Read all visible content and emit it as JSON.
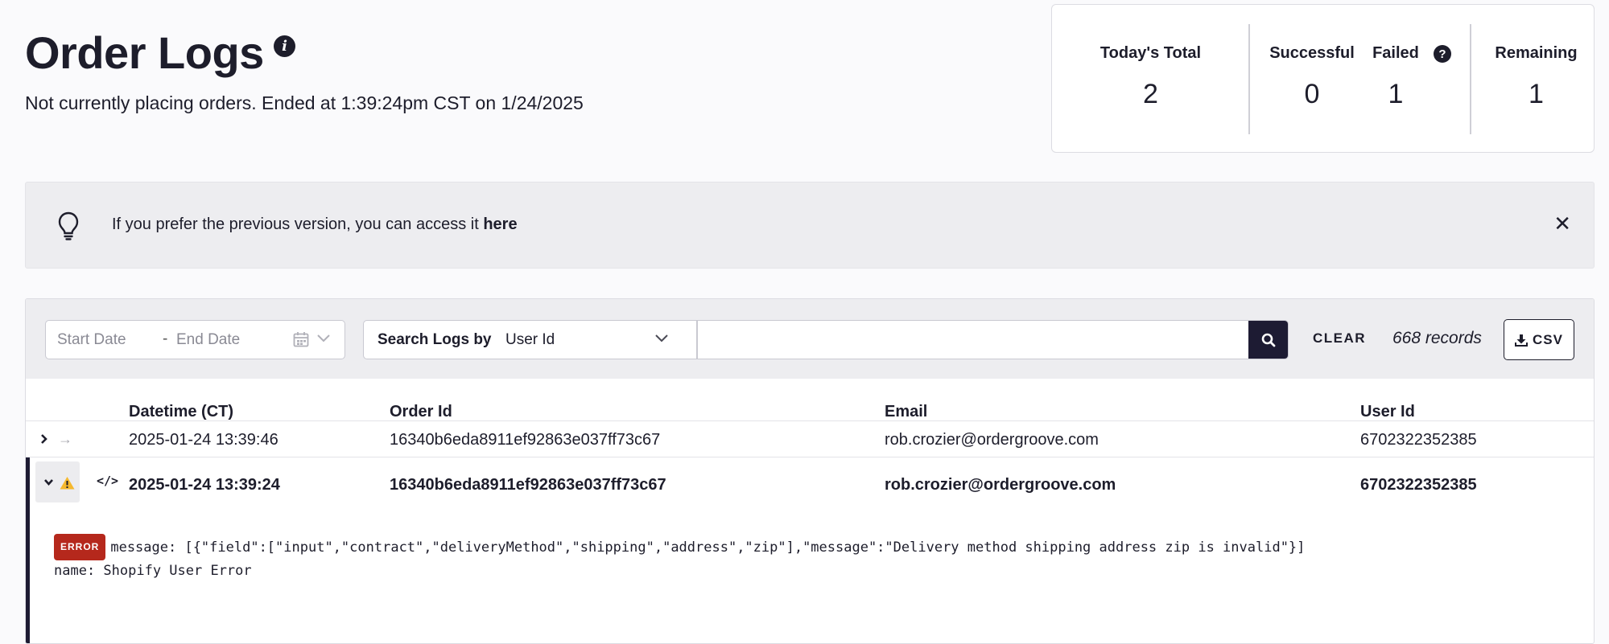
{
  "header": {
    "title": "Order Logs",
    "status": "Not currently placing orders. Ended at 1:39:24pm CST on 1/24/2025"
  },
  "stats": {
    "todays_total": {
      "label": "Today's Total",
      "value": "2"
    },
    "successful": {
      "label": "Successful",
      "value": "0"
    },
    "failed": {
      "label": "Failed",
      "value": "1"
    },
    "remaining": {
      "label": "Remaining",
      "value": "1"
    }
  },
  "banner": {
    "text": "If you prefer the previous version, you can access it ",
    "link_label": "here"
  },
  "toolbar": {
    "start_date_placeholder": "Start Date",
    "date_separator": "-",
    "end_date_placeholder": "End Date",
    "search_by_label": "Search Logs by",
    "search_by_value": "User Id",
    "search_value": "",
    "clear_label": "CLEAR",
    "record_count": "668 records",
    "csv_label": "CSV"
  },
  "table": {
    "columns": [
      "Datetime (CT)",
      "Order Id",
      "Email",
      "User Id"
    ],
    "rows": [
      {
        "datetime": "2025-01-24 13:39:46",
        "order_id": "16340b6eda8911ef92863e037ff73c67",
        "email": "rob.crozier@ordergroove.com",
        "user_id": "6702322352385",
        "status": "success",
        "expanded": false
      },
      {
        "datetime": "2025-01-24 13:39:24",
        "order_id": "16340b6eda8911ef92863e037ff73c67",
        "email": "rob.crozier@ordergroove.com",
        "user_id": "6702322352385",
        "status": "warning",
        "expanded": true,
        "error": {
          "badge": "ERROR",
          "message": "message: [{\"field\":[\"input\",\"contract\",\"deliveryMethod\",\"shipping\",\"address\",\"zip\"],\"message\":\"Delivery method shipping address zip is invalid\"}]",
          "name": "name: Shopify User Error"
        }
      }
    ]
  },
  "colors": {
    "accent_dark": "#1d1b33",
    "error_badge": "#b5281c",
    "warning": "#f5b82e",
    "banner_bg": "#ededf0"
  }
}
